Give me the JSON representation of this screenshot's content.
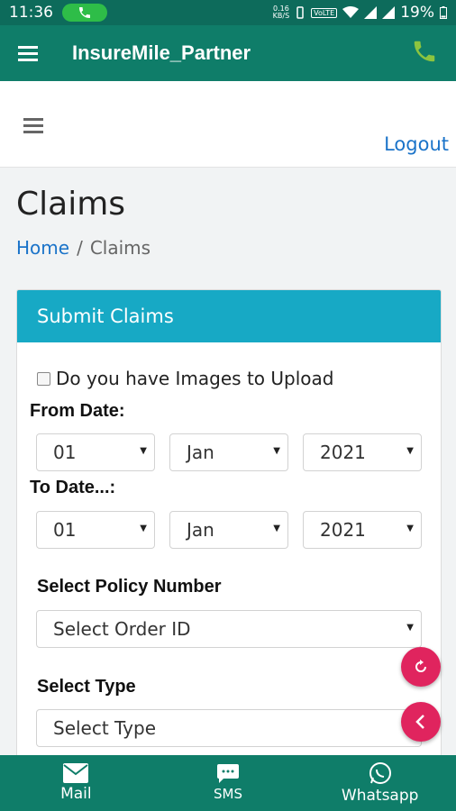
{
  "status_bar": {
    "time": "11:36",
    "speed_value": "0.16",
    "speed_unit": "KB/S",
    "network_tag": "VoLTE",
    "battery": "19%"
  },
  "app_bar": {
    "title": "InsureMile_Partner",
    "menu_icon": "hamburger-icon",
    "call_icon": "phone-icon"
  },
  "web_header": {
    "logout_label": "Logout"
  },
  "page": {
    "title": "Claims",
    "breadcrumb": {
      "home": "Home",
      "separator": "/",
      "current": "Claims"
    }
  },
  "claims_card": {
    "header": "Submit Claims",
    "images_checkbox_label": "Do you have Images to Upload",
    "from_date_label": "From Date:",
    "from_date": {
      "day": "01",
      "month": "Jan",
      "year": "2021"
    },
    "to_date_label": "To Date...:",
    "to_date": {
      "day": "01",
      "month": "Jan",
      "year": "2021"
    },
    "policy_label": "Select Policy Number",
    "policy_select": "Select Order ID",
    "type_label": "Select Type",
    "type_select": "Select Type"
  },
  "bottom_nav": {
    "items": [
      {
        "label": "Mail",
        "icon": "mail-icon"
      },
      {
        "label": "SMS",
        "icon": "sms-icon"
      },
      {
        "label": "Whatsapp",
        "icon": "whatsapp-icon"
      }
    ]
  },
  "colors": {
    "status_bar": "#0d6b5b",
    "app_bar": "#0f7d69",
    "card_header": "#17a9c5",
    "link": "#1a73c9",
    "fab": "#e0245e"
  }
}
